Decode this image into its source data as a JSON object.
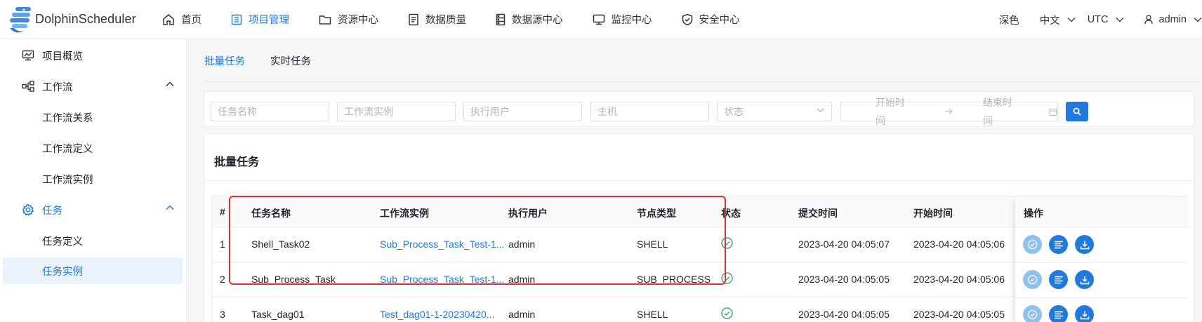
{
  "app": {
    "name": "DolphinScheduler"
  },
  "nav": {
    "items": [
      {
        "label": "首页",
        "icon": "home-icon",
        "active": false
      },
      {
        "label": "项目管理",
        "icon": "project-icon",
        "active": true
      },
      {
        "label": "资源中心",
        "icon": "folder-icon",
        "active": false
      },
      {
        "label": "数据质量",
        "icon": "document-icon",
        "active": false
      },
      {
        "label": "数据源中心",
        "icon": "server-icon",
        "active": false
      },
      {
        "label": "监控中心",
        "icon": "monitor-icon",
        "active": false
      },
      {
        "label": "安全中心",
        "icon": "shield-icon",
        "active": false
      }
    ],
    "theme": "深色",
    "language": "中文",
    "timezone": "UTC",
    "user": "admin"
  },
  "sidebar": {
    "overview": "项目概览",
    "workflow": "工作流",
    "workflow_relation": "工作流关系",
    "workflow_definition": "工作流定义",
    "workflow_instance": "工作流实例",
    "task": "任务",
    "task_definition": "任务定义",
    "task_instance": "任务实例"
  },
  "tabs": {
    "batch": "批量任务",
    "realtime": "实时任务"
  },
  "filters": {
    "task_name": "任务名称",
    "workflow_instance": "工作流实例",
    "executor": "执行用户",
    "host": "主机",
    "state": "状态",
    "start_time": "开始时间",
    "end_time": "结束时间"
  },
  "table": {
    "title": "批量任务",
    "headers": {
      "index": "#",
      "name": "任务名称",
      "workflow_instance": "工作流实例",
      "executor": "执行用户",
      "node_type": "节点类型",
      "state": "状态",
      "submit_time": "提交时间",
      "start_time": "开始时间",
      "operation": "操作"
    },
    "rows": [
      {
        "index": "1",
        "name": "Shell_Task02",
        "workflow_instance": "Sub_Process_Task_Test-1...",
        "executor": "admin",
        "node_type": "SHELL",
        "submit_time": "2023-04-20 04:05:07",
        "start_time": "2023-04-20 04:05:06"
      },
      {
        "index": "2",
        "name": "Sub_Process_Task",
        "workflow_instance": "Sub_Process_Task_Test-1...",
        "executor": "admin",
        "node_type": "SUB_PROCESS",
        "submit_time": "2023-04-20 04:05:05",
        "start_time": "2023-04-20 04:05:06"
      },
      {
        "index": "3",
        "name": "Task_dag01",
        "workflow_instance": "Test_dag01-1-20230420...",
        "executor": "admin",
        "node_type": "SHELL",
        "submit_time": "2023-04-20 04:05:05",
        "start_time": "2023-04-20 04:05:05"
      }
    ]
  },
  "colors": {
    "accent": "#1f7ae0",
    "success": "#18a058",
    "highlight": "#e03131"
  }
}
